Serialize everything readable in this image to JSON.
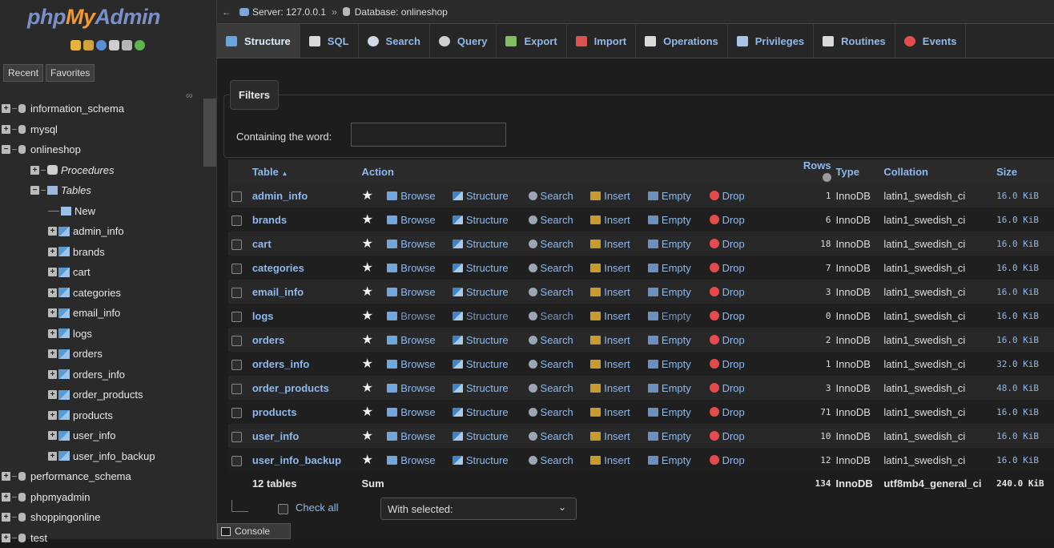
{
  "app": {
    "logo_php": "php",
    "logo_my": "My",
    "logo_admin": "Admin",
    "colors": {
      "background": "#1d1d1d",
      "link": "#8fb9ea",
      "accent_orange": "#f29a2e",
      "drop_red": "#e54b4b"
    }
  },
  "sidebar": {
    "tabs": [
      "Recent",
      "Favorites"
    ],
    "link_icon": "link-icon",
    "tree": [
      {
        "label": "information_schema",
        "level": 0,
        "kind": "db"
      },
      {
        "label": "mysql",
        "level": 0,
        "kind": "db"
      },
      {
        "label": "onlineshop",
        "level": 0,
        "kind": "db-open"
      },
      {
        "label": "Procedures",
        "level": 1,
        "kind": "folder-italic"
      },
      {
        "label": "Tables",
        "level": 1,
        "kind": "folder-open-italic"
      },
      {
        "label": "New",
        "level": 2,
        "kind": "new"
      },
      {
        "label": "admin_info",
        "level": 2,
        "kind": "table"
      },
      {
        "label": "brands",
        "level": 2,
        "kind": "table"
      },
      {
        "label": "cart",
        "level": 2,
        "kind": "table"
      },
      {
        "label": "categories",
        "level": 2,
        "kind": "table"
      },
      {
        "label": "email_info",
        "level": 2,
        "kind": "table"
      },
      {
        "label": "logs",
        "level": 2,
        "kind": "table"
      },
      {
        "label": "orders",
        "level": 2,
        "kind": "table"
      },
      {
        "label": "orders_info",
        "level": 2,
        "kind": "table"
      },
      {
        "label": "order_products",
        "level": 2,
        "kind": "table"
      },
      {
        "label": "products",
        "level": 2,
        "kind": "table"
      },
      {
        "label": "user_info",
        "level": 2,
        "kind": "table"
      },
      {
        "label": "user_info_backup",
        "level": 2,
        "kind": "table"
      },
      {
        "label": "performance_schema",
        "level": 0,
        "kind": "db"
      },
      {
        "label": "phpmyadmin",
        "level": 0,
        "kind": "db"
      },
      {
        "label": "shoppingonline",
        "level": 0,
        "kind": "db"
      },
      {
        "label": "test",
        "level": 0,
        "kind": "db"
      }
    ]
  },
  "breadcrumb": {
    "server": "Server: 127.0.0.1",
    "separator": "»",
    "database": "Database: onlineshop"
  },
  "tabs": [
    {
      "label": "Structure",
      "icon": "structure-icon",
      "active": true
    },
    {
      "label": "SQL",
      "icon": "sql-icon"
    },
    {
      "label": "Search",
      "icon": "search-icon"
    },
    {
      "label": "Query",
      "icon": "query-icon"
    },
    {
      "label": "Export",
      "icon": "export-icon"
    },
    {
      "label": "Import",
      "icon": "import-icon"
    },
    {
      "label": "Operations",
      "icon": "wrench-icon"
    },
    {
      "label": "Privileges",
      "icon": "privileges-icon"
    },
    {
      "label": "Routines",
      "icon": "routines-icon"
    },
    {
      "label": "Events",
      "icon": "events-icon"
    }
  ],
  "filters": {
    "legend": "Filters",
    "label": "Containing the word:",
    "value": ""
  },
  "table": {
    "headers": {
      "table": "Table",
      "sort_indicator": "▲",
      "action": "Action",
      "rows": "Rows",
      "type": "Type",
      "collation": "Collation",
      "size": "Size"
    },
    "actions": [
      "Browse",
      "Structure",
      "Search",
      "Insert",
      "Empty",
      "Drop"
    ],
    "rows": [
      {
        "name": "admin_info",
        "rows": "1",
        "type": "InnoDB",
        "collation": "latin1_swedish_ci",
        "size": "16.0 KiB"
      },
      {
        "name": "brands",
        "rows": "6",
        "type": "InnoDB",
        "collation": "latin1_swedish_ci",
        "size": "16.0 KiB"
      },
      {
        "name": "cart",
        "rows": "18",
        "type": "InnoDB",
        "collation": "latin1_swedish_ci",
        "size": "16.0 KiB"
      },
      {
        "name": "categories",
        "rows": "7",
        "type": "InnoDB",
        "collation": "latin1_swedish_ci",
        "size": "16.0 KiB"
      },
      {
        "name": "email_info",
        "rows": "3",
        "type": "InnoDB",
        "collation": "latin1_swedish_ci",
        "size": "16.0 KiB"
      },
      {
        "name": "logs",
        "rows": "0",
        "type": "InnoDB",
        "collation": "latin1_swedish_ci",
        "size": "16.0 KiB"
      },
      {
        "name": "orders",
        "rows": "2",
        "type": "InnoDB",
        "collation": "latin1_swedish_ci",
        "size": "16.0 KiB"
      },
      {
        "name": "orders_info",
        "rows": "1",
        "type": "InnoDB",
        "collation": "latin1_swedish_ci",
        "size": "32.0 KiB"
      },
      {
        "name": "order_products",
        "rows": "3",
        "type": "InnoDB",
        "collation": "latin1_swedish_ci",
        "size": "48.0 KiB"
      },
      {
        "name": "products",
        "rows": "71",
        "type": "InnoDB",
        "collation": "latin1_swedish_ci",
        "size": "16.0 KiB"
      },
      {
        "name": "user_info",
        "rows": "10",
        "type": "InnoDB",
        "collation": "latin1_swedish_ci",
        "size": "16.0 KiB"
      },
      {
        "name": "user_info_backup",
        "rows": "12",
        "type": "InnoDB",
        "collation": "latin1_swedish_ci",
        "size": "16.0 KiB"
      }
    ],
    "footer": {
      "count": "12 tables",
      "action": "Sum",
      "rows": "134",
      "type": "InnoDB",
      "collation": "utf8mb4_general_ci",
      "size": "240.0 KiB"
    }
  },
  "bulk": {
    "check_all": "Check all",
    "with_selected": "With selected:"
  },
  "console": {
    "label": "Console"
  }
}
